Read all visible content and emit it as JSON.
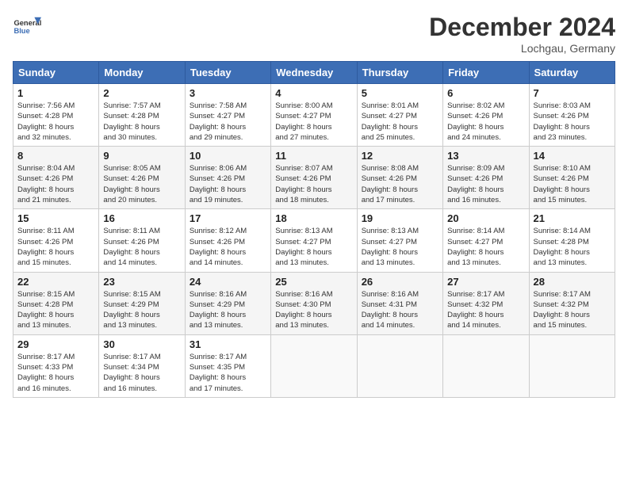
{
  "header": {
    "logo_line1": "General",
    "logo_line2": "Blue",
    "month": "December 2024",
    "location": "Lochgau, Germany"
  },
  "weekdays": [
    "Sunday",
    "Monday",
    "Tuesday",
    "Wednesday",
    "Thursday",
    "Friday",
    "Saturday"
  ],
  "weeks": [
    [
      {
        "day": "1",
        "info": "Sunrise: 7:56 AM\nSunset: 4:28 PM\nDaylight: 8 hours\nand 32 minutes."
      },
      {
        "day": "2",
        "info": "Sunrise: 7:57 AM\nSunset: 4:28 PM\nDaylight: 8 hours\nand 30 minutes."
      },
      {
        "day": "3",
        "info": "Sunrise: 7:58 AM\nSunset: 4:27 PM\nDaylight: 8 hours\nand 29 minutes."
      },
      {
        "day": "4",
        "info": "Sunrise: 8:00 AM\nSunset: 4:27 PM\nDaylight: 8 hours\nand 27 minutes."
      },
      {
        "day": "5",
        "info": "Sunrise: 8:01 AM\nSunset: 4:27 PM\nDaylight: 8 hours\nand 25 minutes."
      },
      {
        "day": "6",
        "info": "Sunrise: 8:02 AM\nSunset: 4:26 PM\nDaylight: 8 hours\nand 24 minutes."
      },
      {
        "day": "7",
        "info": "Sunrise: 8:03 AM\nSunset: 4:26 PM\nDaylight: 8 hours\nand 23 minutes."
      }
    ],
    [
      {
        "day": "8",
        "info": "Sunrise: 8:04 AM\nSunset: 4:26 PM\nDaylight: 8 hours\nand 21 minutes."
      },
      {
        "day": "9",
        "info": "Sunrise: 8:05 AM\nSunset: 4:26 PM\nDaylight: 8 hours\nand 20 minutes."
      },
      {
        "day": "10",
        "info": "Sunrise: 8:06 AM\nSunset: 4:26 PM\nDaylight: 8 hours\nand 19 minutes."
      },
      {
        "day": "11",
        "info": "Sunrise: 8:07 AM\nSunset: 4:26 PM\nDaylight: 8 hours\nand 18 minutes."
      },
      {
        "day": "12",
        "info": "Sunrise: 8:08 AM\nSunset: 4:26 PM\nDaylight: 8 hours\nand 17 minutes."
      },
      {
        "day": "13",
        "info": "Sunrise: 8:09 AM\nSunset: 4:26 PM\nDaylight: 8 hours\nand 16 minutes."
      },
      {
        "day": "14",
        "info": "Sunrise: 8:10 AM\nSunset: 4:26 PM\nDaylight: 8 hours\nand 15 minutes."
      }
    ],
    [
      {
        "day": "15",
        "info": "Sunrise: 8:11 AM\nSunset: 4:26 PM\nDaylight: 8 hours\nand 15 minutes."
      },
      {
        "day": "16",
        "info": "Sunrise: 8:11 AM\nSunset: 4:26 PM\nDaylight: 8 hours\nand 14 minutes."
      },
      {
        "day": "17",
        "info": "Sunrise: 8:12 AM\nSunset: 4:26 PM\nDaylight: 8 hours\nand 14 minutes."
      },
      {
        "day": "18",
        "info": "Sunrise: 8:13 AM\nSunset: 4:27 PM\nDaylight: 8 hours\nand 13 minutes."
      },
      {
        "day": "19",
        "info": "Sunrise: 8:13 AM\nSunset: 4:27 PM\nDaylight: 8 hours\nand 13 minutes."
      },
      {
        "day": "20",
        "info": "Sunrise: 8:14 AM\nSunset: 4:27 PM\nDaylight: 8 hours\nand 13 minutes."
      },
      {
        "day": "21",
        "info": "Sunrise: 8:14 AM\nSunset: 4:28 PM\nDaylight: 8 hours\nand 13 minutes."
      }
    ],
    [
      {
        "day": "22",
        "info": "Sunrise: 8:15 AM\nSunset: 4:28 PM\nDaylight: 8 hours\nand 13 minutes."
      },
      {
        "day": "23",
        "info": "Sunrise: 8:15 AM\nSunset: 4:29 PM\nDaylight: 8 hours\nand 13 minutes."
      },
      {
        "day": "24",
        "info": "Sunrise: 8:16 AM\nSunset: 4:29 PM\nDaylight: 8 hours\nand 13 minutes."
      },
      {
        "day": "25",
        "info": "Sunrise: 8:16 AM\nSunset: 4:30 PM\nDaylight: 8 hours\nand 13 minutes."
      },
      {
        "day": "26",
        "info": "Sunrise: 8:16 AM\nSunset: 4:31 PM\nDaylight: 8 hours\nand 14 minutes."
      },
      {
        "day": "27",
        "info": "Sunrise: 8:17 AM\nSunset: 4:32 PM\nDaylight: 8 hours\nand 14 minutes."
      },
      {
        "day": "28",
        "info": "Sunrise: 8:17 AM\nSunset: 4:32 PM\nDaylight: 8 hours\nand 15 minutes."
      }
    ],
    [
      {
        "day": "29",
        "info": "Sunrise: 8:17 AM\nSunset: 4:33 PM\nDaylight: 8 hours\nand 16 minutes."
      },
      {
        "day": "30",
        "info": "Sunrise: 8:17 AM\nSunset: 4:34 PM\nDaylight: 8 hours\nand 16 minutes."
      },
      {
        "day": "31",
        "info": "Sunrise: 8:17 AM\nSunset: 4:35 PM\nDaylight: 8 hours\nand 17 minutes."
      },
      null,
      null,
      null,
      null
    ]
  ]
}
